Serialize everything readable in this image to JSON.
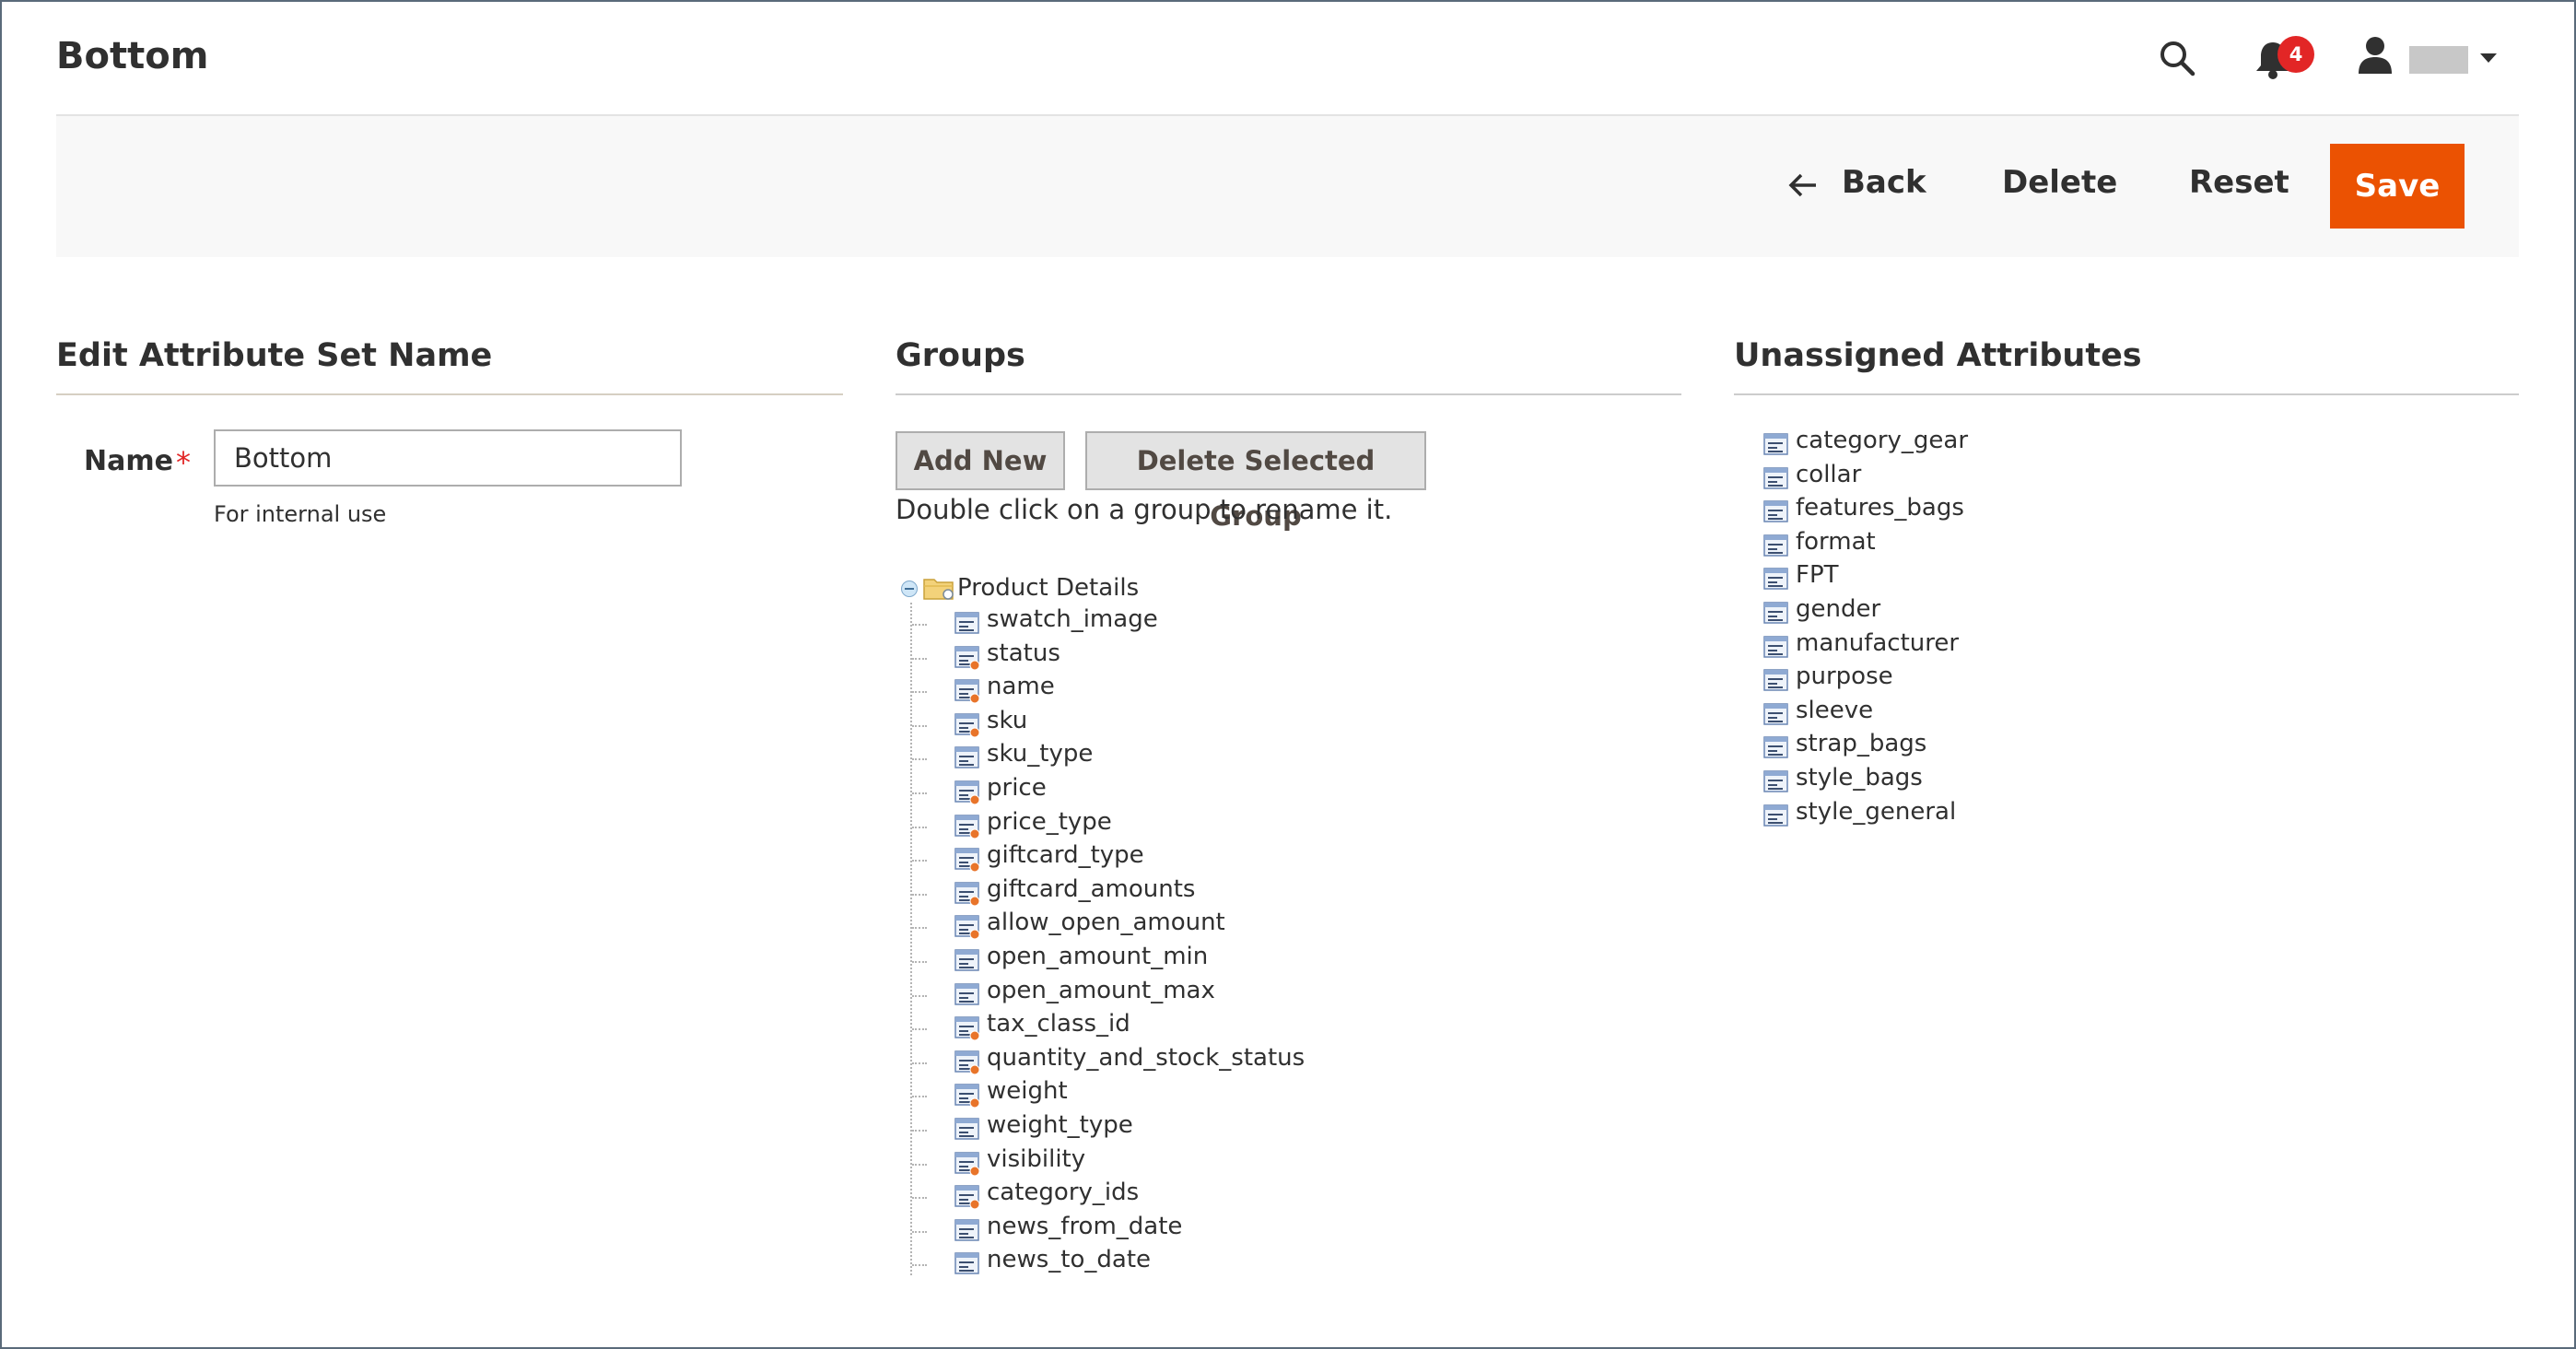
{
  "header": {
    "title": "Bottom",
    "notification_count": "4"
  },
  "actions": {
    "back": "Back",
    "delete": "Delete",
    "reset": "Reset",
    "save": "Save"
  },
  "edit_section": {
    "title": "Edit Attribute Set Name",
    "name_label": "Name",
    "required_mark": "*",
    "name_value": "Bottom",
    "note": "For internal use"
  },
  "groups_section": {
    "title": "Groups",
    "add_new": "Add New",
    "delete_selected": "Delete Selected Group",
    "hint": "Double click on a group to rename it.",
    "group_name": "Product Details",
    "attributes": [
      {
        "label": "swatch_image",
        "system": false
      },
      {
        "label": "status",
        "system": true
      },
      {
        "label": "name",
        "system": true
      },
      {
        "label": "sku",
        "system": true
      },
      {
        "label": "sku_type",
        "system": false
      },
      {
        "label": "price",
        "system": true
      },
      {
        "label": "price_type",
        "system": true
      },
      {
        "label": "giftcard_type",
        "system": true
      },
      {
        "label": "giftcard_amounts",
        "system": true
      },
      {
        "label": "allow_open_amount",
        "system": true
      },
      {
        "label": "open_amount_min",
        "system": false
      },
      {
        "label": "open_amount_max",
        "system": false
      },
      {
        "label": "tax_class_id",
        "system": true
      },
      {
        "label": "quantity_and_stock_status",
        "system": true
      },
      {
        "label": "weight",
        "system": true
      },
      {
        "label": "weight_type",
        "system": false
      },
      {
        "label": "visibility",
        "system": true
      },
      {
        "label": "category_ids",
        "system": true
      },
      {
        "label": "news_from_date",
        "system": false
      },
      {
        "label": "news_to_date",
        "system": false
      }
    ]
  },
  "unassigned_section": {
    "title": "Unassigned Attributes",
    "attributes": [
      "category_gear",
      "collar",
      "features_bags",
      "format",
      "FPT",
      "gender",
      "manufacturer",
      "purpose",
      "sleeve",
      "strap_bags",
      "style_bags",
      "style_general"
    ]
  },
  "colors": {
    "save_button": "#eb5202",
    "badge": "#e22626",
    "required": "#e22626"
  }
}
